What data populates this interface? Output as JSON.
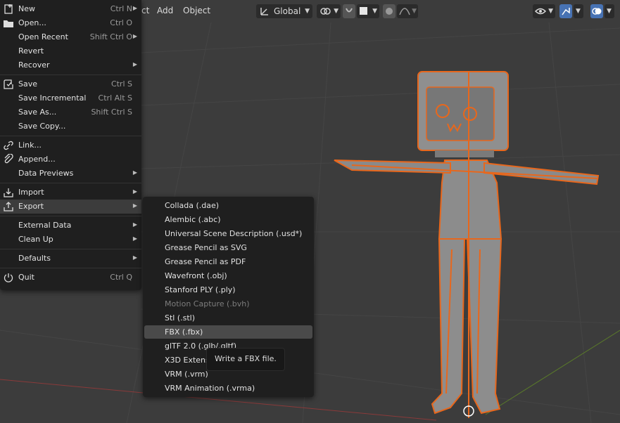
{
  "header": {
    "menu_partial": "ct",
    "menu_add": "Add",
    "menu_object": "Object",
    "transform_orientation": "Global"
  },
  "file_menu": {
    "items": [
      {
        "label": "New",
        "shortcut": "Ctrl N",
        "icon": "new-file-icon",
        "submenu": true
      },
      {
        "label": "Open...",
        "shortcut": "Ctrl O",
        "icon": "folder-icon",
        "submenu": false
      },
      {
        "label": "Open Recent",
        "shortcut": "Shift Ctrl O",
        "icon": "",
        "submenu": true
      },
      {
        "label": "Revert",
        "shortcut": "",
        "icon": "",
        "submenu": false
      },
      {
        "label": "Recover",
        "shortcut": "",
        "icon": "",
        "submenu": true
      },
      {
        "label": "Save",
        "shortcut": "Ctrl S",
        "icon": "save-icon",
        "submenu": false
      },
      {
        "label": "Save Incremental",
        "shortcut": "Ctrl Alt S",
        "icon": "",
        "submenu": false
      },
      {
        "label": "Save As...",
        "shortcut": "Shift Ctrl S",
        "icon": "",
        "submenu": false
      },
      {
        "label": "Save Copy...",
        "shortcut": "",
        "icon": "",
        "submenu": false
      },
      {
        "label": "Link...",
        "shortcut": "",
        "icon": "link-icon",
        "submenu": false
      },
      {
        "label": "Append...",
        "shortcut": "",
        "icon": "append-icon",
        "submenu": false
      },
      {
        "label": "Data Previews",
        "shortcut": "",
        "icon": "",
        "submenu": true
      },
      {
        "label": "Import",
        "shortcut": "",
        "icon": "import-icon",
        "submenu": true
      },
      {
        "label": "Export",
        "shortcut": "",
        "icon": "export-icon",
        "submenu": true
      },
      {
        "label": "External Data",
        "shortcut": "",
        "icon": "",
        "submenu": true
      },
      {
        "label": "Clean Up",
        "shortcut": "",
        "icon": "",
        "submenu": true
      },
      {
        "label": "Defaults",
        "shortcut": "",
        "icon": "",
        "submenu": true
      },
      {
        "label": "Quit",
        "shortcut": "Ctrl Q",
        "icon": "power-icon",
        "submenu": false
      }
    ]
  },
  "export_menu": {
    "items": [
      {
        "label": "Collada (.dae)",
        "disabled": false
      },
      {
        "label": "Alembic (.abc)",
        "disabled": false
      },
      {
        "label": "Universal Scene Description (.usd*)",
        "disabled": false
      },
      {
        "label": "Grease Pencil as SVG",
        "disabled": false
      },
      {
        "label": "Grease Pencil as PDF",
        "disabled": false
      },
      {
        "label": "Wavefront (.obj)",
        "disabled": false
      },
      {
        "label": "Stanford PLY (.ply)",
        "disabled": false
      },
      {
        "label": "Motion Capture (.bvh)",
        "disabled": true
      },
      {
        "label": "Stl (.stl)",
        "disabled": false
      },
      {
        "label": "FBX (.fbx)",
        "disabled": false
      },
      {
        "label": "glTF 2.0 (.glb/.gltf)",
        "disabled": false
      },
      {
        "label": "X3D Extensible 3D (.x3d)",
        "disabled": false
      },
      {
        "label": "VRM (.vrm)",
        "disabled": false
      },
      {
        "label": "VRM Animation (.vrma)",
        "disabled": false
      }
    ],
    "hovered": "FBX (.fbx)"
  },
  "tooltip": {
    "text": "Write a FBX file."
  },
  "colors": {
    "menu_bg": "#1f1f1f",
    "selection_orange": "#e8671c",
    "active_blue": "#4772b3",
    "viewport_bg": "#3c3c3c"
  }
}
